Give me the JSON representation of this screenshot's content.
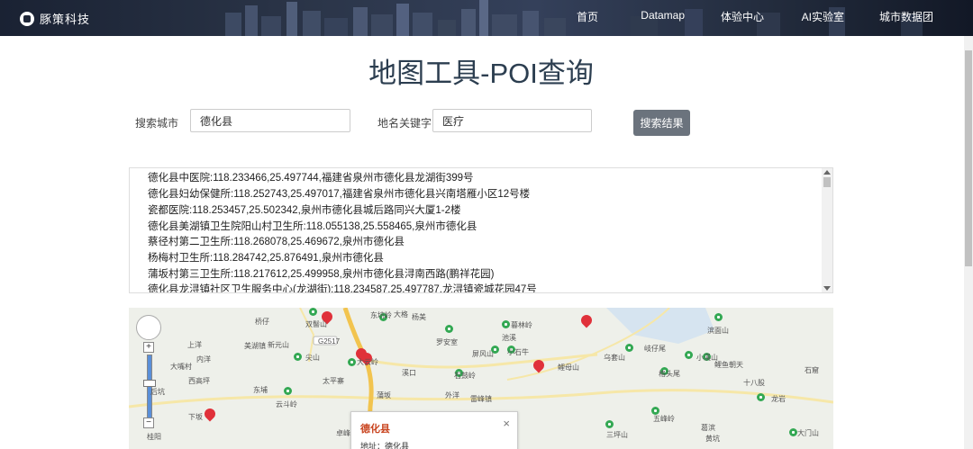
{
  "header": {
    "brand": "豚策科技",
    "nav": [
      {
        "label": "首页"
      },
      {
        "label": "Datamap"
      },
      {
        "label": "体验中心"
      },
      {
        "label": "AI实验室"
      },
      {
        "label": "城市数据团"
      }
    ]
  },
  "page_title": "地图工具-POI查询",
  "form": {
    "city_label": "搜索城市",
    "city_value": "德化县",
    "keyword_label": "地名关键字",
    "keyword_value": "医疗",
    "search_button": "搜索结果"
  },
  "results": [
    "德化县中医院:118.233466,25.497744,福建省泉州市德化县龙湖街399号",
    "德化县妇幼保健所:118.252743,25.497017,福建省泉州市德化县兴南塔雁小区12号楼",
    "瓷都医院:118.253457,25.502342,泉州市德化县城后路同兴大厦1-2楼",
    "德化县美湖镇卫生院阳山村卫生所:118.055138,25.558465,泉州市德化县",
    "蔡径村第二卫生所:118.268078,25.469672,泉州市德化县",
    "杨梅村卫生所:118.284742,25.876491,泉州市德化县",
    "蒲坂村第三卫生所:118.217612,25.499958,泉州市德化县浔南西路(鹏祥花园)",
    "德化县龙浔镇社区卫生服务中心(龙湖街):118.234587,25.497787,龙浔镇瓷城花园47号"
  ],
  "map": {
    "places": [
      "双髻山",
      "东坑岭",
      "大格",
      "桥仔",
      "杨美",
      "上洋",
      "美湖镇",
      "新元山",
      "尖山",
      "大云岭",
      "溪口",
      "石鼓岭",
      "罗安室",
      "屏风山",
      "小石牛",
      "暮林岭",
      "池溪",
      "鲤母山",
      "乌套山",
      "岐仔尾",
      "小溪山",
      "滨面山",
      "格头尾",
      "鲤鱼朝天",
      "十八股",
      "石窟",
      "大嘴村",
      "内洋",
      "西高坪",
      "后坑",
      "云斗岭",
      "太平寨",
      "东埔",
      "下坂",
      "蒲坂",
      "外洋",
      "雷峰镇",
      "龙岩",
      "五峰岭",
      "大门山",
      "三坪山",
      "卓峰",
      "桂阳",
      "葛滨",
      "黄坑"
    ],
    "road_label": "G2517",
    "popup": {
      "title": "德化县",
      "address": "地址：德化县",
      "close": "×"
    }
  }
}
